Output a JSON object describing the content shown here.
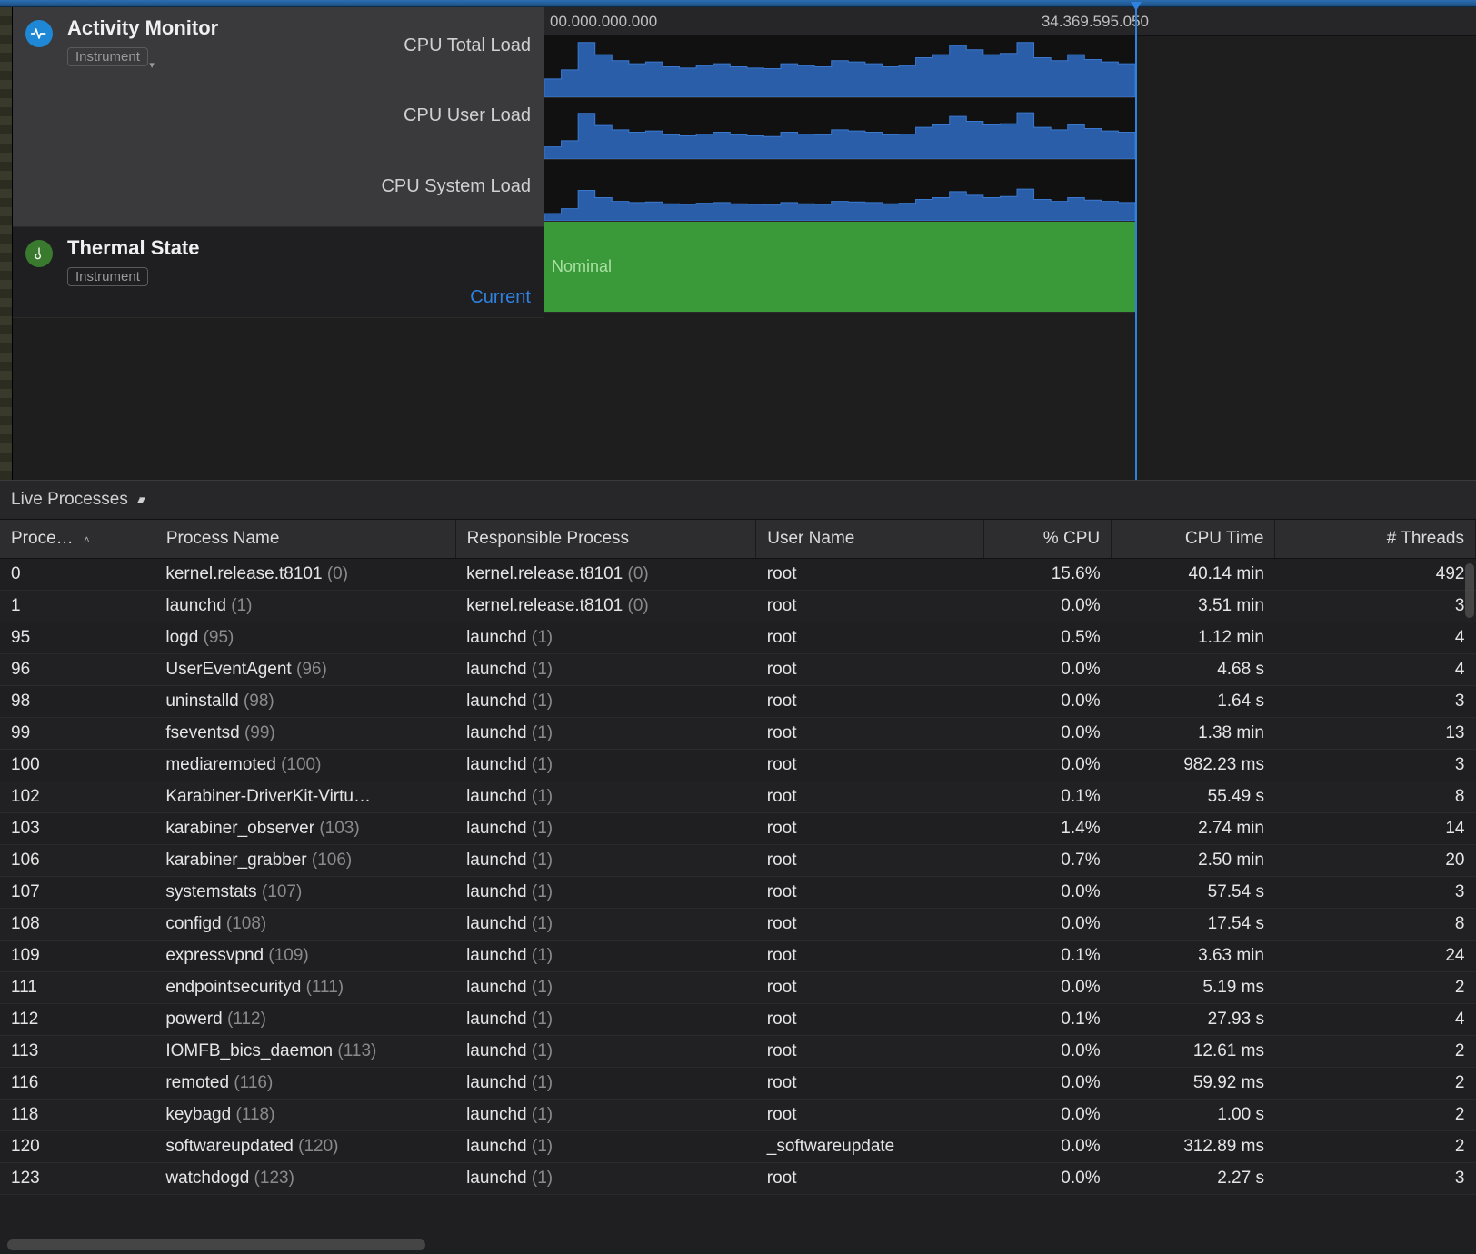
{
  "ruler": {
    "start": "00.000.000.000",
    "end": "34.369.595.050"
  },
  "instruments": {
    "activity": {
      "title": "Activity Monitor",
      "badge": "Instrument",
      "lanes": [
        "CPU Total Load",
        "CPU User Load",
        "CPU System Load"
      ]
    },
    "thermal": {
      "title": "Thermal State",
      "badge": "Instrument",
      "current_label": "Current",
      "state": "Nominal"
    }
  },
  "filter": {
    "label": "Live Processes"
  },
  "columns": {
    "pid": "Proce…",
    "pname": "Process Name",
    "resp": "Responsible Process",
    "user": "User Name",
    "cpu": "% CPU",
    "time": "CPU Time",
    "threads": "# Threads"
  },
  "rows": [
    {
      "pid": "0",
      "pname": "kernel.release.t8101",
      "pname_pid": "(0)",
      "resp": "kernel.release.t8101",
      "resp_pid": "(0)",
      "user": "root",
      "cpu": "15.6%",
      "time": "40.14 min",
      "threads": "492"
    },
    {
      "pid": "1",
      "pname": "launchd",
      "pname_pid": "(1)",
      "resp": "kernel.release.t8101",
      "resp_pid": "(0)",
      "user": "root",
      "cpu": "0.0%",
      "time": "3.51 min",
      "threads": "3"
    },
    {
      "pid": "95",
      "pname": "logd",
      "pname_pid": "(95)",
      "resp": "launchd",
      "resp_pid": "(1)",
      "user": "root",
      "cpu": "0.5%",
      "time": "1.12 min",
      "threads": "4"
    },
    {
      "pid": "96",
      "pname": "UserEventAgent",
      "pname_pid": "(96)",
      "resp": "launchd",
      "resp_pid": "(1)",
      "user": "root",
      "cpu": "0.0%",
      "time": "4.68 s",
      "threads": "4"
    },
    {
      "pid": "98",
      "pname": "uninstalld",
      "pname_pid": "(98)",
      "resp": "launchd",
      "resp_pid": "(1)",
      "user": "root",
      "cpu": "0.0%",
      "time": "1.64 s",
      "threads": "3"
    },
    {
      "pid": "99",
      "pname": "fseventsd",
      "pname_pid": "(99)",
      "resp": "launchd",
      "resp_pid": "(1)",
      "user": "root",
      "cpu": "0.0%",
      "time": "1.38 min",
      "threads": "13"
    },
    {
      "pid": "100",
      "pname": "mediaremoted",
      "pname_pid": "(100)",
      "resp": "launchd",
      "resp_pid": "(1)",
      "user": "root",
      "cpu": "0.0%",
      "time": "982.23 ms",
      "threads": "3"
    },
    {
      "pid": "102",
      "pname": "Karabiner-DriverKit-Virtu…",
      "pname_pid": "",
      "resp": "launchd",
      "resp_pid": "(1)",
      "user": "root",
      "cpu": "0.1%",
      "time": "55.49 s",
      "threads": "8"
    },
    {
      "pid": "103",
      "pname": "karabiner_observer",
      "pname_pid": "(103)",
      "resp": "launchd",
      "resp_pid": "(1)",
      "user": "root",
      "cpu": "1.4%",
      "time": "2.74 min",
      "threads": "14"
    },
    {
      "pid": "106",
      "pname": "karabiner_grabber",
      "pname_pid": "(106)",
      "resp": "launchd",
      "resp_pid": "(1)",
      "user": "root",
      "cpu": "0.7%",
      "time": "2.50 min",
      "threads": "20"
    },
    {
      "pid": "107",
      "pname": "systemstats",
      "pname_pid": "(107)",
      "resp": "launchd",
      "resp_pid": "(1)",
      "user": "root",
      "cpu": "0.0%",
      "time": "57.54 s",
      "threads": "3"
    },
    {
      "pid": "108",
      "pname": "configd",
      "pname_pid": "(108)",
      "resp": "launchd",
      "resp_pid": "(1)",
      "user": "root",
      "cpu": "0.0%",
      "time": "17.54 s",
      "threads": "8"
    },
    {
      "pid": "109",
      "pname": "expressvpnd",
      "pname_pid": "(109)",
      "resp": "launchd",
      "resp_pid": "(1)",
      "user": "root",
      "cpu": "0.1%",
      "time": "3.63 min",
      "threads": "24"
    },
    {
      "pid": "111",
      "pname": "endpointsecurityd",
      "pname_pid": "(111)",
      "resp": "launchd",
      "resp_pid": "(1)",
      "user": "root",
      "cpu": "0.0%",
      "time": "5.19 ms",
      "threads": "2"
    },
    {
      "pid": "112",
      "pname": "powerd",
      "pname_pid": "(112)",
      "resp": "launchd",
      "resp_pid": "(1)",
      "user": "root",
      "cpu": "0.1%",
      "time": "27.93 s",
      "threads": "4"
    },
    {
      "pid": "113",
      "pname": "IOMFB_bics_daemon",
      "pname_pid": "(113)",
      "resp": "launchd",
      "resp_pid": "(1)",
      "user": "root",
      "cpu": "0.0%",
      "time": "12.61 ms",
      "threads": "2"
    },
    {
      "pid": "116",
      "pname": "remoted",
      "pname_pid": "(116)",
      "resp": "launchd",
      "resp_pid": "(1)",
      "user": "root",
      "cpu": "0.0%",
      "time": "59.92 ms",
      "threads": "2"
    },
    {
      "pid": "118",
      "pname": "keybagd",
      "pname_pid": "(118)",
      "resp": "launchd",
      "resp_pid": "(1)",
      "user": "root",
      "cpu": "0.0%",
      "time": "1.00 s",
      "threads": "2"
    },
    {
      "pid": "120",
      "pname": "softwareupdated",
      "pname_pid": "(120)",
      "resp": "launchd",
      "resp_pid": "(1)",
      "user": "_softwareupdate",
      "cpu": "0.0%",
      "time": "312.89 ms",
      "threads": "2"
    },
    {
      "pid": "123",
      "pname": "watchdogd",
      "pname_pid": "(123)",
      "resp": "launchd",
      "resp_pid": "(1)",
      "user": "root",
      "cpu": "0.0%",
      "time": "2.27 s",
      "threads": "3"
    }
  ],
  "chart_data": [
    {
      "type": "area",
      "title": "CPU Total Load",
      "ylim": [
        0,
        100
      ],
      "x": [
        0,
        1,
        2,
        3,
        4,
        5,
        6,
        7,
        8,
        9,
        10,
        11,
        12,
        13,
        14,
        15,
        16,
        17,
        18,
        19,
        20,
        21,
        22,
        23,
        24,
        25,
        26,
        27,
        28,
        29,
        30,
        31,
        32,
        33,
        34
      ],
      "values": [
        30,
        45,
        90,
        70,
        60,
        55,
        58,
        50,
        48,
        52,
        55,
        50,
        48,
        47,
        55,
        52,
        50,
        60,
        58,
        55,
        50,
        52,
        65,
        70,
        85,
        78,
        70,
        72,
        90,
        65,
        60,
        70,
        62,
        58,
        55
      ]
    },
    {
      "type": "area",
      "title": "CPU User Load",
      "ylim": [
        0,
        100
      ],
      "x": [
        0,
        1,
        2,
        3,
        4,
        5,
        6,
        7,
        8,
        9,
        10,
        11,
        12,
        13,
        14,
        15,
        16,
        17,
        18,
        19,
        20,
        21,
        22,
        23,
        24,
        25,
        26,
        27,
        28,
        29,
        30,
        31,
        32,
        33,
        34
      ],
      "values": [
        20,
        30,
        75,
        55,
        48,
        44,
        46,
        40,
        38,
        41,
        44,
        40,
        38,
        37,
        44,
        41,
        40,
        48,
        46,
        44,
        40,
        41,
        52,
        56,
        70,
        62,
        56,
        58,
        76,
        52,
        48,
        56,
        50,
        46,
        44
      ]
    },
    {
      "type": "area",
      "title": "CPU System Load",
      "ylim": [
        0,
        100
      ],
      "x": [
        0,
        1,
        2,
        3,
        4,
        5,
        6,
        7,
        8,
        9,
        10,
        11,
        12,
        13,
        14,
        15,
        16,
        17,
        18,
        19,
        20,
        21,
        22,
        23,
        24,
        25,
        26,
        27,
        28,
        29,
        30,
        31,
        32,
        33,
        34
      ],
      "values": [
        12,
        20,
        50,
        38,
        32,
        30,
        31,
        28,
        27,
        29,
        30,
        28,
        27,
        26,
        30,
        28,
        27,
        32,
        31,
        30,
        28,
        29,
        35,
        38,
        48,
        42,
        38,
        40,
        52,
        35,
        32,
        38,
        34,
        32,
        30
      ]
    }
  ]
}
